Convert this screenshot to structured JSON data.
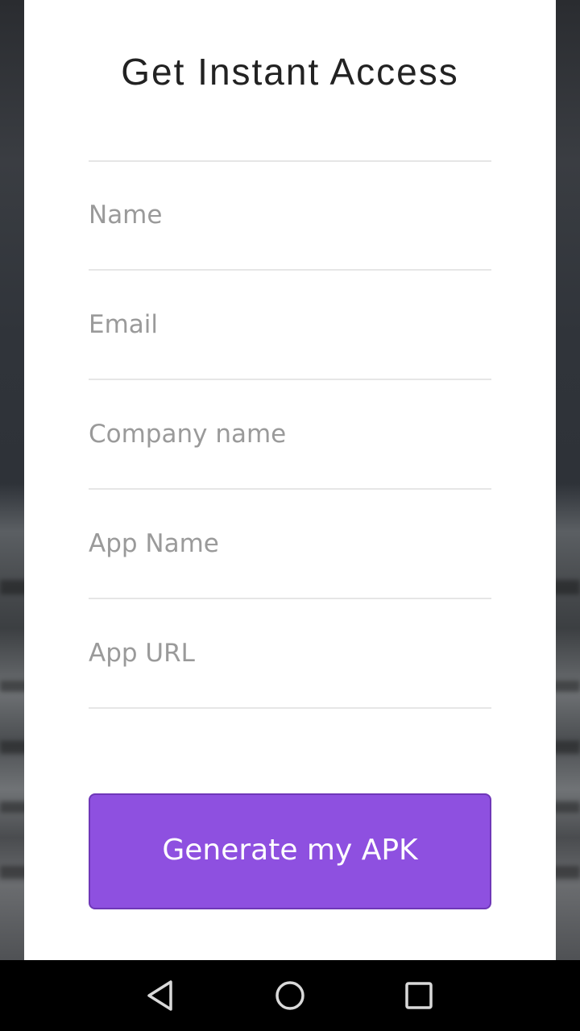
{
  "form": {
    "title": "Get Instant Access",
    "fields": [
      {
        "placeholder": "Name",
        "value": ""
      },
      {
        "placeholder": "Email",
        "value": ""
      },
      {
        "placeholder": "Company name",
        "value": ""
      },
      {
        "placeholder": "App Name",
        "value": ""
      },
      {
        "placeholder": "App URL",
        "value": ""
      }
    ],
    "submit_label": "Generate my APK"
  },
  "colors": {
    "accent": "#8e50e0",
    "card": "#ffffff",
    "nav_bar": "#000000"
  },
  "nav_bar": {
    "icons": [
      "back-icon",
      "home-icon",
      "recents-icon"
    ]
  }
}
